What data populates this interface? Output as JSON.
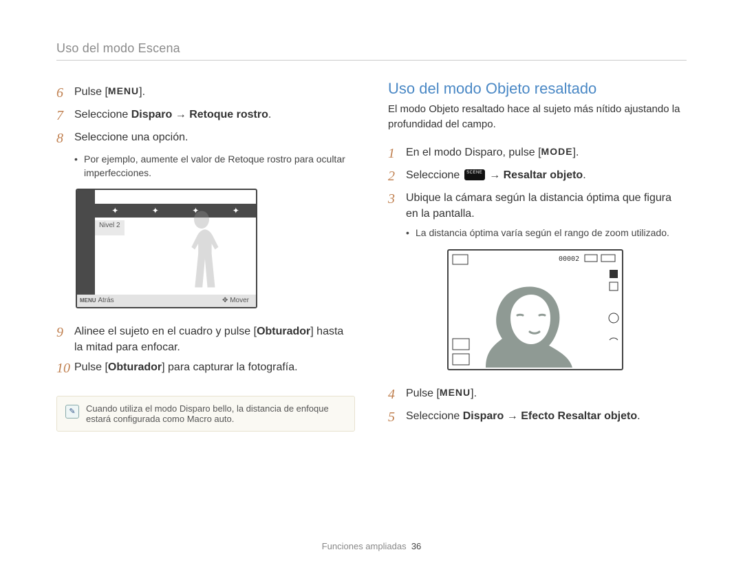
{
  "breadcrumb": "Uso del modo Escena",
  "left": {
    "steps": {
      "s6": {
        "num": "6",
        "pre": "Pulse [",
        "key": "MENU",
        "post": "]."
      },
      "s7": {
        "num": "7",
        "pre": "Seleccione ",
        "b1": "Disparo",
        "arrow": " → ",
        "b2": "Retoque rostro",
        "post": "."
      },
      "s8": {
        "num": "8",
        "text": "Seleccione una opción."
      },
      "s8_sub": "Por ejemplo, aumente el valor de Retoque rostro para ocultar imperfecciones.",
      "s9": {
        "num": "9",
        "pre": "Alinee el sujeto en el cuadro y pulse [",
        "b": "Obturador",
        "post": "] hasta la mitad para enfocar."
      },
      "s10": {
        "num": "10",
        "pre": "Pulse [",
        "b": "Obturador",
        "post": "] para capturar la fotografía."
      }
    },
    "lcd": {
      "label": "Nivel 2",
      "back": "Atrás",
      "move": "Mover",
      "menu": "MENU"
    },
    "tip": "Cuando utiliza el modo Disparo bello, la distancia de enfoque estará configurada como Macro auto."
  },
  "right": {
    "title": "Uso del modo Objeto resaltado",
    "intro": "El modo Objeto resaltado hace al sujeto más nítido ajustando la profundidad del campo.",
    "steps": {
      "s1": {
        "num": "1",
        "pre": "En el modo Disparo, pulse [",
        "key": "MODE",
        "post": "]."
      },
      "s2": {
        "num": "2",
        "pre": "Seleccione ",
        "arrow": " → ",
        "b": "Resaltar objeto",
        "post": "."
      },
      "s3": {
        "num": "3",
        "text": "Ubique la cámara según la distancia óptima que figura en la pantalla."
      },
      "s3_sub": "La distancia óptima varía según el rango de zoom utilizado.",
      "s4": {
        "num": "4",
        "pre": "Pulse [",
        "key": "MENU",
        "post": "]."
      },
      "s5": {
        "num": "5",
        "pre": "Seleccione ",
        "b1": "Disparo",
        "arrow": " → ",
        "b2": "Efecto Resaltar objeto",
        "post": "."
      }
    },
    "lcd2": {
      "counter": "00002"
    }
  },
  "footer": {
    "section": "Funciones ampliadas",
    "page": "36"
  }
}
